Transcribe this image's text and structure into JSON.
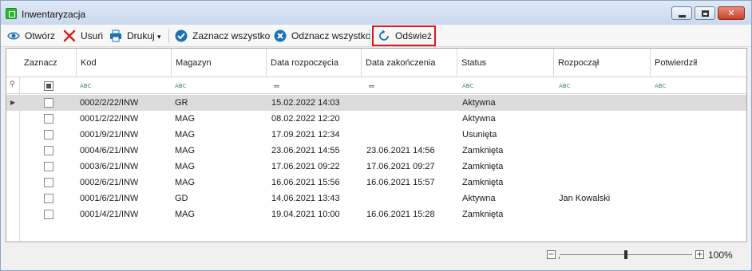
{
  "window": {
    "title": "Inwentaryzacja"
  },
  "toolbar": {
    "open": "Otwórz",
    "delete": "Usuń",
    "print": "Drukuj",
    "print_caret": "▾",
    "select_all": "Zaznacz wszystko",
    "deselect_all": "Odznacz wszystko",
    "refresh": "Odśwież"
  },
  "colors": {
    "highlight": "#e0141e",
    "selected_row": "#dcdcdc",
    "accent_blue": "#1f6fb2"
  },
  "columns": [
    "Zaznacz",
    "Kod",
    "Magazyn",
    "Data rozpoczęcia",
    "Data zakończenia",
    "Status",
    "Rozpoczął",
    "Potwierdził"
  ],
  "filter_row": {
    "text_glyph": "A",
    "text_glyph_b": "B",
    "text_glyph_c": "C",
    "date_glyph": "═"
  },
  "rows": [
    {
      "kod": "0002/2/22/INW",
      "magazyn": "GR",
      "start": "15.02.2022 14:03",
      "end": "",
      "status": "Aktywna",
      "rozpoczal": "",
      "potwierdzil": ""
    },
    {
      "kod": "0001/2/22/INW",
      "magazyn": "MAG",
      "start": "08.02.2022 12:20",
      "end": "",
      "status": "Aktywna",
      "rozpoczal": "",
      "potwierdzil": ""
    },
    {
      "kod": "0001/9/21/INW",
      "magazyn": "MAG",
      "start": "17.09.2021 12:34",
      "end": "",
      "status": "Usunięta",
      "rozpoczal": "",
      "potwierdzil": ""
    },
    {
      "kod": "0004/6/21/INW",
      "magazyn": "MAG",
      "start": "23.06.2021 14:55",
      "end": "23.06.2021 14:56",
      "status": "Zamknięta",
      "rozpoczal": "",
      "potwierdzil": ""
    },
    {
      "kod": "0003/6/21/INW",
      "magazyn": "MAG",
      "start": "17.06.2021 09:22",
      "end": "17.06.2021 09:27",
      "status": "Zamknięta",
      "rozpoczal": "",
      "potwierdzil": ""
    },
    {
      "kod": "0002/6/21/INW",
      "magazyn": "MAG",
      "start": "16.06.2021 15:56",
      "end": "16.06.2021 15:57",
      "status": "Zamknięta",
      "rozpoczal": "",
      "potwierdzil": ""
    },
    {
      "kod": "0001/6/21/INW",
      "magazyn": "GD",
      "start": "14.06.2021 13:43",
      "end": "",
      "status": "Aktywna",
      "rozpoczal": "Jan Kowalski",
      "potwierdzil": ""
    },
    {
      "kod": "0001/4/21/INW",
      "magazyn": "MAG",
      "start": "19.04.2021 10:00",
      "end": "16.06.2021 15:28",
      "status": "Zamknięta",
      "rozpoczal": "",
      "potwierdzil": ""
    }
  ],
  "selected_row_marker": "▶",
  "zoom": {
    "level": "100%",
    "minus": "−",
    "plus": "+",
    "fraction": 0.5
  }
}
